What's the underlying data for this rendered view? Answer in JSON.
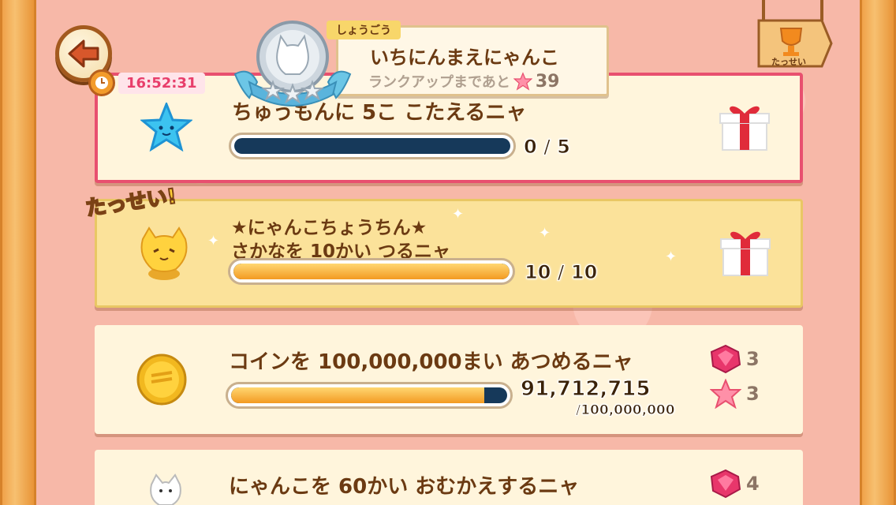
{
  "header": {
    "timer": "16:52:31",
    "rank_label": "しょうごう",
    "rank_title": "いちにんまえにゃんこ",
    "rank_next_text": "ランクアップまであと",
    "rank_next_count": "39",
    "trophy_label": "たっせい"
  },
  "missions": [
    {
      "text": "ちゅうもんに 5こ こたえるニャ",
      "current": "0",
      "separator": "/",
      "target": "5",
      "progress": 0,
      "icon": "blue-star-icon",
      "reward": "gift-icon"
    },
    {
      "badge": "たっせい!",
      "text_line1": "★にゃんこちょうちん★",
      "text_line2": "さかなを 10かい つるニャ",
      "current": "10",
      "separator": "/",
      "target": "10",
      "progress": 1.0,
      "icon": "cat-lantern-icon",
      "reward": "gift-icon"
    },
    {
      "text": "コインを 100,000,000まい あつめるニャ",
      "current": "91,712,715",
      "target": "/100,000,000",
      "progress": 0.917,
      "icon": "coin-icon",
      "rewards": [
        {
          "icon": "gem-icon",
          "count": "3"
        },
        {
          "icon": "pink-star-icon",
          "count": "3"
        }
      ]
    },
    {
      "text": "にゃんこを 60かい おむかえするニャ",
      "icon": "white-cat-icon",
      "rewards": [
        {
          "icon": "gem-icon",
          "count": "4"
        }
      ]
    }
  ],
  "colors": {
    "background": "#f7b8a8",
    "card": "#fff5dc",
    "card_achieved": "#fbe29a",
    "card_border_active": "#e8506f",
    "text_brown": "#6b3a12",
    "progress_track": "#16395a",
    "progress_fill": "#f39a22",
    "timer_text": "#e83e6b"
  }
}
